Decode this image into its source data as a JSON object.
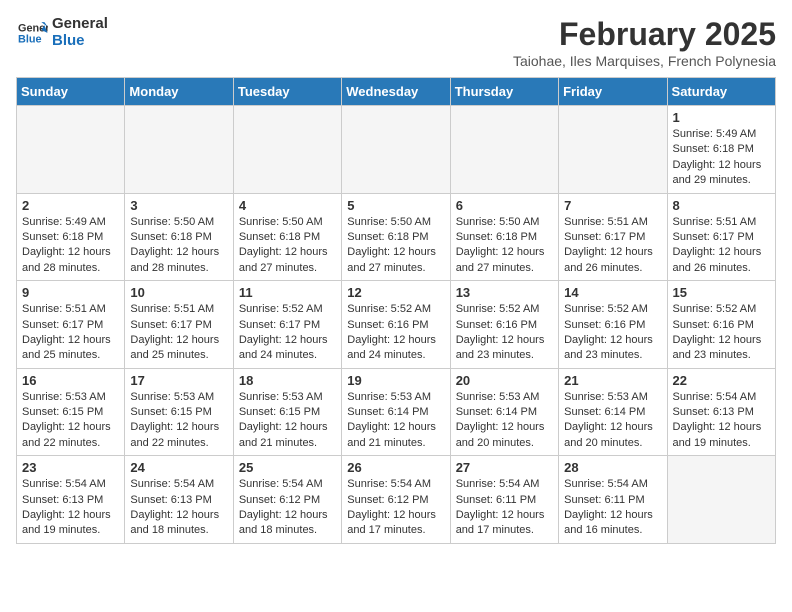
{
  "header": {
    "logo_line1": "General",
    "logo_line2": "Blue",
    "month_year": "February 2025",
    "location": "Taiohae, Iles Marquises, French Polynesia"
  },
  "weekdays": [
    "Sunday",
    "Monday",
    "Tuesday",
    "Wednesday",
    "Thursday",
    "Friday",
    "Saturday"
  ],
  "weeks": [
    [
      {
        "day": "",
        "info": ""
      },
      {
        "day": "",
        "info": ""
      },
      {
        "day": "",
        "info": ""
      },
      {
        "day": "",
        "info": ""
      },
      {
        "day": "",
        "info": ""
      },
      {
        "day": "",
        "info": ""
      },
      {
        "day": "1",
        "info": "Sunrise: 5:49 AM\nSunset: 6:18 PM\nDaylight: 12 hours\nand 29 minutes."
      }
    ],
    [
      {
        "day": "2",
        "info": "Sunrise: 5:49 AM\nSunset: 6:18 PM\nDaylight: 12 hours\nand 28 minutes."
      },
      {
        "day": "3",
        "info": "Sunrise: 5:50 AM\nSunset: 6:18 PM\nDaylight: 12 hours\nand 28 minutes."
      },
      {
        "day": "4",
        "info": "Sunrise: 5:50 AM\nSunset: 6:18 PM\nDaylight: 12 hours\nand 27 minutes."
      },
      {
        "day": "5",
        "info": "Sunrise: 5:50 AM\nSunset: 6:18 PM\nDaylight: 12 hours\nand 27 minutes."
      },
      {
        "day": "6",
        "info": "Sunrise: 5:50 AM\nSunset: 6:18 PM\nDaylight: 12 hours\nand 27 minutes."
      },
      {
        "day": "7",
        "info": "Sunrise: 5:51 AM\nSunset: 6:17 PM\nDaylight: 12 hours\nand 26 minutes."
      },
      {
        "day": "8",
        "info": "Sunrise: 5:51 AM\nSunset: 6:17 PM\nDaylight: 12 hours\nand 26 minutes."
      }
    ],
    [
      {
        "day": "9",
        "info": "Sunrise: 5:51 AM\nSunset: 6:17 PM\nDaylight: 12 hours\nand 25 minutes."
      },
      {
        "day": "10",
        "info": "Sunrise: 5:51 AM\nSunset: 6:17 PM\nDaylight: 12 hours\nand 25 minutes."
      },
      {
        "day": "11",
        "info": "Sunrise: 5:52 AM\nSunset: 6:17 PM\nDaylight: 12 hours\nand 24 minutes."
      },
      {
        "day": "12",
        "info": "Sunrise: 5:52 AM\nSunset: 6:16 PM\nDaylight: 12 hours\nand 24 minutes."
      },
      {
        "day": "13",
        "info": "Sunrise: 5:52 AM\nSunset: 6:16 PM\nDaylight: 12 hours\nand 23 minutes."
      },
      {
        "day": "14",
        "info": "Sunrise: 5:52 AM\nSunset: 6:16 PM\nDaylight: 12 hours\nand 23 minutes."
      },
      {
        "day": "15",
        "info": "Sunrise: 5:52 AM\nSunset: 6:16 PM\nDaylight: 12 hours\nand 23 minutes."
      }
    ],
    [
      {
        "day": "16",
        "info": "Sunrise: 5:53 AM\nSunset: 6:15 PM\nDaylight: 12 hours\nand 22 minutes."
      },
      {
        "day": "17",
        "info": "Sunrise: 5:53 AM\nSunset: 6:15 PM\nDaylight: 12 hours\nand 22 minutes."
      },
      {
        "day": "18",
        "info": "Sunrise: 5:53 AM\nSunset: 6:15 PM\nDaylight: 12 hours\nand 21 minutes."
      },
      {
        "day": "19",
        "info": "Sunrise: 5:53 AM\nSunset: 6:14 PM\nDaylight: 12 hours\nand 21 minutes."
      },
      {
        "day": "20",
        "info": "Sunrise: 5:53 AM\nSunset: 6:14 PM\nDaylight: 12 hours\nand 20 minutes."
      },
      {
        "day": "21",
        "info": "Sunrise: 5:53 AM\nSunset: 6:14 PM\nDaylight: 12 hours\nand 20 minutes."
      },
      {
        "day": "22",
        "info": "Sunrise: 5:54 AM\nSunset: 6:13 PM\nDaylight: 12 hours\nand 19 minutes."
      }
    ],
    [
      {
        "day": "23",
        "info": "Sunrise: 5:54 AM\nSunset: 6:13 PM\nDaylight: 12 hours\nand 19 minutes."
      },
      {
        "day": "24",
        "info": "Sunrise: 5:54 AM\nSunset: 6:13 PM\nDaylight: 12 hours\nand 18 minutes."
      },
      {
        "day": "25",
        "info": "Sunrise: 5:54 AM\nSunset: 6:12 PM\nDaylight: 12 hours\nand 18 minutes."
      },
      {
        "day": "26",
        "info": "Sunrise: 5:54 AM\nSunset: 6:12 PM\nDaylight: 12 hours\nand 17 minutes."
      },
      {
        "day": "27",
        "info": "Sunrise: 5:54 AM\nSunset: 6:11 PM\nDaylight: 12 hours\nand 17 minutes."
      },
      {
        "day": "28",
        "info": "Sunrise: 5:54 AM\nSunset: 6:11 PM\nDaylight: 12 hours\nand 16 minutes."
      },
      {
        "day": "",
        "info": ""
      }
    ]
  ]
}
